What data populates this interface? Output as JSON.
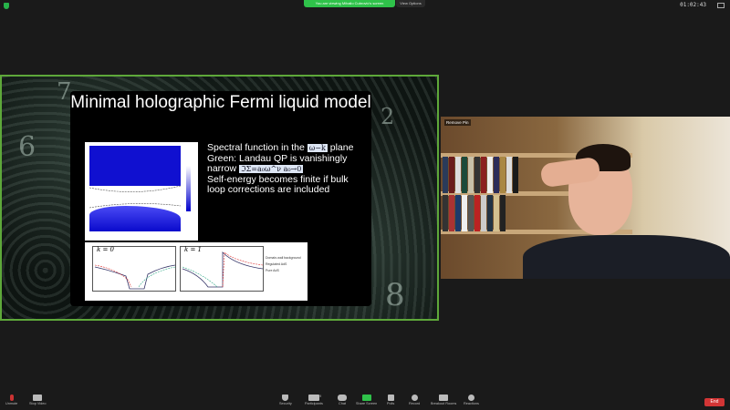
{
  "top": {
    "banner": "You are viewing Mihailo Cubrovic's screen",
    "view_options": "View Options",
    "timer": "01:02:43"
  },
  "slide": {
    "title": "Minimal holographic Fermi liquid model",
    "bullet1_pre": "Spectral function in the",
    "bullet1_math": "ω−k",
    "bullet1_post": "plane",
    "bullet2": "Green: Landau QP is vanishingly narrow",
    "bullet2_math": "ℑΣ=a₀ω^ν  a₀→0",
    "bullet3": "Self-energy becomes finite if bulk loop corrections are included",
    "plot2": {
      "panel1_label": "k = 0",
      "panel2_label": "k = 1",
      "legend": [
        "Domain-wall background",
        "Regulated AdS",
        "Pure AdS"
      ]
    }
  },
  "video": {
    "participant_label": "Remove Pin"
  },
  "toolbar": {
    "items": [
      "Unmute",
      "Stop Video",
      "Security",
      "Participants",
      "Chat",
      "Share Screen",
      "Polls",
      "Record",
      "Breakout Rooms",
      "Reactions"
    ],
    "participants_count": "19",
    "end": "End"
  },
  "colors": {
    "accent_green": "#2fc24a",
    "share_border": "#5ea83a",
    "end_red": "#d23535"
  }
}
